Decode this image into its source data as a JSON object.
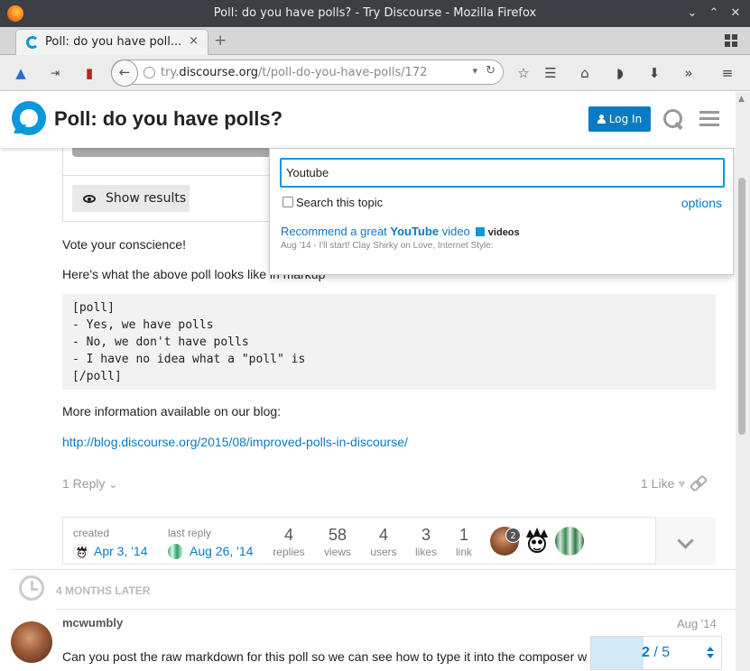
{
  "window": {
    "title": "Poll: do you have polls? - Try Discourse - Mozilla Firefox"
  },
  "tab": {
    "label": "Poll: do you have poll...",
    "close": "×",
    "new": "+"
  },
  "urlbar": {
    "host": "try.",
    "domain": "discourse.org",
    "path": "/t/poll-do-you-have-polls/172"
  },
  "header": {
    "title": "Poll: do you have polls?",
    "login_label": "Log In"
  },
  "poll": {
    "show_results": "Show results"
  },
  "post": {
    "vote": "Vote your conscience!",
    "markup_intro": "Here's what the above poll looks like in markup",
    "code": "[poll]\n- Yes, we have polls\n- No, we don't have polls\n- I have no idea what a \"poll\" is\n[/poll]",
    "blog_intro": "More information available on our blog:",
    "blog_link": "http://blog.discourse.org/2015/08/improved-polls-in-discourse/",
    "reply": "1 Reply",
    "like": "1 Like"
  },
  "summary": {
    "created_label": "created",
    "created_date": "Apr 3, '14",
    "last_reply_label": "last reply",
    "last_reply_date": "Aug 26, '14",
    "stats": [
      {
        "num": "4",
        "label": "replies"
      },
      {
        "num": "58",
        "label": "views"
      },
      {
        "num": "4",
        "label": "users"
      },
      {
        "num": "3",
        "label": "likes"
      },
      {
        "num": "1",
        "label": "link"
      }
    ],
    "badge": "2"
  },
  "gap": {
    "label": "4 MONTHS LATER"
  },
  "next_post": {
    "username": "mcwumbly",
    "date": "Aug '14",
    "text": "Can you post the raw markdown for this poll so we can see how to type it into the composer w"
  },
  "progress": {
    "current": "2",
    "sep": " / ",
    "total": "5",
    "fraction": 0.4
  },
  "search": {
    "query": "Youtube",
    "checkbox_label": "Search this topic",
    "options": "options",
    "result_pre": "Recommend a great ",
    "result_hl": "YouTube",
    "result_post": " video",
    "category": "videos",
    "meta": "Aug '14 - I'll start! Clay Shirky on Love, Internet Style:"
  }
}
